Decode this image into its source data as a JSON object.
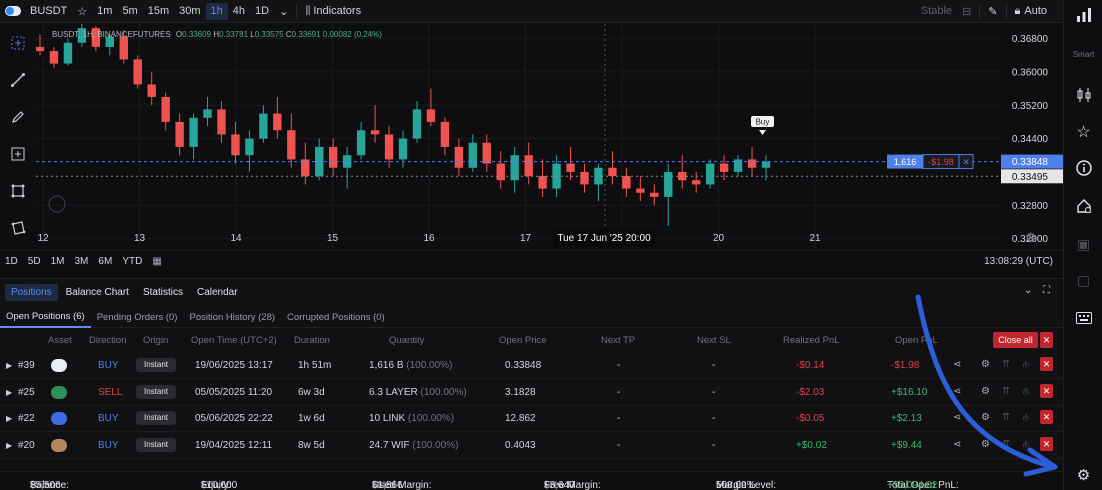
{
  "toolbar": {
    "symbol": "BUSDT",
    "timeframes": [
      "1m",
      "5m",
      "15m",
      "30m",
      "1h",
      "4h",
      "1D"
    ],
    "active_timeframe": "1h",
    "indicators_label": "Indicators",
    "stable_label": "Stable",
    "auto_label": "Auto"
  },
  "legend": {
    "title": "BUSDT, 1H, BINANCEFUTURES",
    "o_label": "O",
    "o": "0.33609",
    "h_label": "H",
    "h": "0.33781",
    "l_label": "L",
    "l": "0.33575",
    "c_label": "C",
    "c": "0.33691",
    "change": "0.00082 (0.24%)"
  },
  "chart_data": {
    "type": "candlestick",
    "title": "BUSDT, 1H, BINANCEFUTURES",
    "price_ticks": [
      "0.36800",
      "0.36000",
      "0.35200",
      "0.34400",
      "0.32800",
      "0.32000"
    ],
    "time_ticks": [
      "12",
      "13",
      "14",
      "15",
      "16",
      "17",
      "19",
      "20",
      "21"
    ],
    "crosshair_time": "Tue 17 Jun '25   20:00",
    "ylim": [
      0.3175,
      0.3715
    ],
    "current_price": "0.33848",
    "reference_price": "0.33495",
    "position_line": {
      "quantity": "1,616",
      "pnl": "-$1.98"
    },
    "buy_marker": "Buy",
    "ohlc": [
      [
        0.366,
        0.369,
        0.364,
        0.365
      ],
      [
        0.365,
        0.366,
        0.361,
        0.362
      ],
      [
        0.362,
        0.368,
        0.3615,
        0.367
      ],
      [
        0.367,
        0.372,
        0.366,
        0.3705
      ],
      [
        0.3705,
        0.371,
        0.365,
        0.366
      ],
      [
        0.366,
        0.369,
        0.364,
        0.3685
      ],
      [
        0.3685,
        0.37,
        0.362,
        0.363
      ],
      [
        0.363,
        0.364,
        0.356,
        0.357
      ],
      [
        0.357,
        0.36,
        0.352,
        0.354
      ],
      [
        0.354,
        0.355,
        0.346,
        0.348
      ],
      [
        0.348,
        0.35,
        0.34,
        0.342
      ],
      [
        0.342,
        0.35,
        0.339,
        0.349
      ],
      [
        0.349,
        0.354,
        0.347,
        0.351
      ],
      [
        0.351,
        0.353,
        0.343,
        0.345
      ],
      [
        0.345,
        0.348,
        0.338,
        0.34
      ],
      [
        0.34,
        0.346,
        0.336,
        0.344
      ],
      [
        0.344,
        0.352,
        0.343,
        0.35
      ],
      [
        0.35,
        0.354,
        0.344,
        0.346
      ],
      [
        0.346,
        0.35,
        0.337,
        0.339
      ],
      [
        0.339,
        0.343,
        0.333,
        0.335
      ],
      [
        0.335,
        0.344,
        0.334,
        0.342
      ],
      [
        0.342,
        0.344,
        0.335,
        0.337
      ],
      [
        0.337,
        0.342,
        0.332,
        0.34
      ],
      [
        0.34,
        0.348,
        0.339,
        0.346
      ],
      [
        0.346,
        0.352,
        0.343,
        0.345
      ],
      [
        0.345,
        0.347,
        0.337,
        0.339
      ],
      [
        0.339,
        0.346,
        0.337,
        0.344
      ],
      [
        0.344,
        0.353,
        0.343,
        0.351
      ],
      [
        0.351,
        0.356,
        0.347,
        0.348
      ],
      [
        0.348,
        0.349,
        0.34,
        0.342
      ],
      [
        0.342,
        0.344,
        0.335,
        0.337
      ],
      [
        0.337,
        0.345,
        0.336,
        0.343
      ],
      [
        0.343,
        0.345,
        0.336,
        0.338
      ],
      [
        0.338,
        0.341,
        0.332,
        0.334
      ],
      [
        0.334,
        0.342,
        0.331,
        0.34
      ],
      [
        0.34,
        0.343,
        0.333,
        0.335
      ],
      [
        0.335,
        0.339,
        0.33,
        0.332
      ],
      [
        0.332,
        0.34,
        0.33,
        0.338
      ],
      [
        0.338,
        0.342,
        0.334,
        0.336
      ],
      [
        0.336,
        0.338,
        0.331,
        0.333
      ],
      [
        0.333,
        0.338,
        0.329,
        0.337
      ],
      [
        0.337,
        0.341,
        0.333,
        0.335
      ],
      [
        0.335,
        0.337,
        0.33,
        0.332
      ],
      [
        0.332,
        0.335,
        0.329,
        0.331
      ],
      [
        0.331,
        0.333,
        0.328,
        0.33
      ],
      [
        0.33,
        0.338,
        0.323,
        0.336
      ],
      [
        0.336,
        0.34,
        0.332,
        0.334
      ],
      [
        0.334,
        0.336,
        0.331,
        0.333
      ],
      [
        0.333,
        0.339,
        0.332,
        0.338
      ],
      [
        0.338,
        0.34,
        0.334,
        0.336
      ],
      [
        0.336,
        0.34,
        0.335,
        0.339
      ],
      [
        0.339,
        0.342,
        0.335,
        0.337
      ],
      [
        0.337,
        0.34,
        0.334,
        0.3385
      ]
    ]
  },
  "left_tools": [
    "crosshair-icon",
    "trendline-icon",
    "pencil-icon",
    "text-icon",
    "rectangle-icon",
    "polygon-icon"
  ],
  "range_bar": {
    "ranges": [
      "1D",
      "5D",
      "1M",
      "3M",
      "6M",
      "YTD"
    ],
    "clock": "13:08:29 (UTC)"
  },
  "panel": {
    "tabs": [
      "Positions",
      "Balance Chart",
      "Statistics",
      "Calendar"
    ],
    "subtabs": [
      "Open Positions (6)",
      "Pending Orders (0)",
      "Position History (28)",
      "Corrupted Positions (0)"
    ],
    "columns": [
      "Asset",
      "Direction",
      "Origin",
      "Open Time (UTC+2)",
      "Duration",
      "Quantity",
      "Open Price",
      "Next TP",
      "Next SL",
      "Realized PnL",
      "Open PnL"
    ],
    "close_all": "Close all",
    "rows": [
      {
        "id": "#39",
        "direction": "BUY",
        "origin": "Instant",
        "open_time": "19/06/2025 13:17",
        "duration": "1h 51m",
        "qty": "1,616",
        "unit": "B",
        "pct": "(100.00%)",
        "open_price": "0.33848",
        "tp": "-",
        "sl": "-",
        "realized": "-$0.14",
        "open_pnl": "-$1.98"
      },
      {
        "id": "#25",
        "direction": "SELL",
        "origin": "Instant",
        "open_time": "05/05/2025 11:20",
        "duration": "6w 3d",
        "qty": "6.3",
        "unit": "LAYER",
        "pct": "(100.00%)",
        "open_price": "3.1828",
        "tp": "-",
        "sl": "-",
        "realized": "-$2.03",
        "open_pnl": "+$16.10"
      },
      {
        "id": "#22",
        "direction": "BUY",
        "origin": "Instant",
        "open_time": "05/06/2025 22:22",
        "duration": "1w 6d",
        "qty": "10",
        "unit": "LINK",
        "pct": "(100.00%)",
        "open_price": "12.862",
        "tp": "-",
        "sl": "-",
        "realized": "-$0.05",
        "open_pnl": "+$2.13"
      },
      {
        "id": "#20",
        "direction": "BUY",
        "origin": "Instant",
        "open_time": "19/04/2025 12:11",
        "duration": "8w 5d",
        "qty": "24.7",
        "unit": "WIF",
        "pct": "(100.00%)",
        "open_price": "0.4043",
        "tp": "-",
        "sl": "-",
        "realized": "+$0.02",
        "open_pnl": "+$9.44"
      }
    ]
  },
  "status": {
    "balance_label": "Balance:",
    "balance": "$5,506",
    "balance_dec": ".75",
    "equity_label": "Equity:",
    "equity": "$10,600",
    "equity_dec": ".77",
    "used_margin_label": "Used Margin:",
    "used_margin": "$1,866",
    "used_margin_dec": ".04",
    "free_margin_label": "Free Margin:",
    "free_margin": "$3,640",
    "free_margin_dec": ".71",
    "margin_level_label": "Margin Level:",
    "margin_level": "568.09%",
    "total_pnl_label": "Total Open PnL:",
    "total_pnl": "+$5,094.02"
  },
  "right_bar": {
    "smart_label": "Smart"
  },
  "colors": {
    "up": "#26a69a",
    "down": "#ef5350",
    "accent": "#4f7fe8",
    "danger": "#c4262f"
  }
}
